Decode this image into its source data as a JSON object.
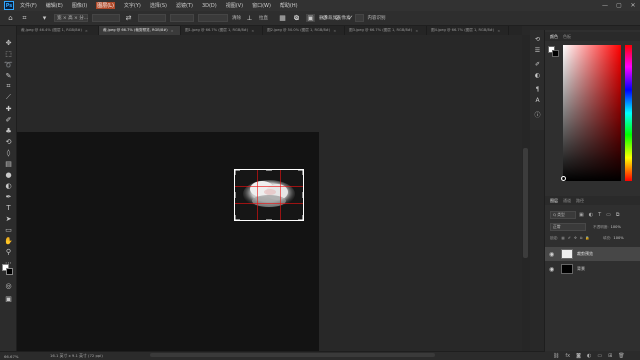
{
  "menubar": {
    "logo": "Ps",
    "items": [
      "文件(F)",
      "编辑(E)",
      "图像(I)",
      "图层(L)",
      "文字(Y)",
      "选择(S)",
      "滤镜(T)",
      "3D(D)",
      "视图(V)",
      "窗口(W)",
      "帮助(H)"
    ],
    "highlight_index": 3,
    "window_controls": [
      "—",
      "▢",
      "✕"
    ]
  },
  "options": {
    "ratio": "宽 × 高 × 分...",
    "clear": "清除",
    "straighten": "拉直",
    "delete_cropped": "删除裁剪的像素",
    "fill": "内容识别"
  },
  "tabs": [
    {
      "label": "裁.jpeg @ 46.4% (图层 1, RGB/8#)",
      "active": false
    },
    {
      "label": "裁.jpeg @ 66.7% (裁剪预览, RGB/8#)",
      "active": true
    },
    {
      "label": "图1.jpeg @ 66.7% (图层 1, RGB/8#)",
      "active": false
    },
    {
      "label": "图2.jpeg @ 50.0% (图层 1, RGB/8#)",
      "active": false
    },
    {
      "label": "图3.jpeg @ 66.7% (图层 1, RGB/8#)",
      "active": false
    },
    {
      "label": "图4.jpeg @ 66.7% (图层 1, RGB/8#)",
      "active": false
    }
  ],
  "tools": [
    "move",
    "marquee",
    "lasso",
    "quick-select",
    "crop",
    "eyedropper",
    "healing",
    "brush",
    "stamp",
    "history-brush",
    "eraser",
    "gradient",
    "blur",
    "dodge",
    "pen",
    "type",
    "path-select",
    "rectangle",
    "hand",
    "zoom",
    "more"
  ],
  "panels": {
    "color_tabs": [
      "颜色",
      "色板"
    ],
    "layer_tabs": [
      "图层",
      "通道",
      "路径"
    ],
    "layer_search": "Q 类型",
    "blend_mode": "正常",
    "opacity_label": "不透明度:",
    "opacity_value": "100%",
    "lock_label": "锁定:",
    "fill_label": "填充:",
    "fill_value": "100%",
    "layers": [
      {
        "name": "裁剪预览",
        "selected": true,
        "thumb": "#eeeeee"
      },
      {
        "name": "背景",
        "selected": false,
        "thumb": "#000000"
      }
    ]
  },
  "status": {
    "zoom": "66.67%",
    "doc_info": "16.1 英寸 x 9.1 英寸 (72 ppi)"
  },
  "colors": {
    "accent": "#31a8ff",
    "menu_highlight": "#b04a2a"
  }
}
